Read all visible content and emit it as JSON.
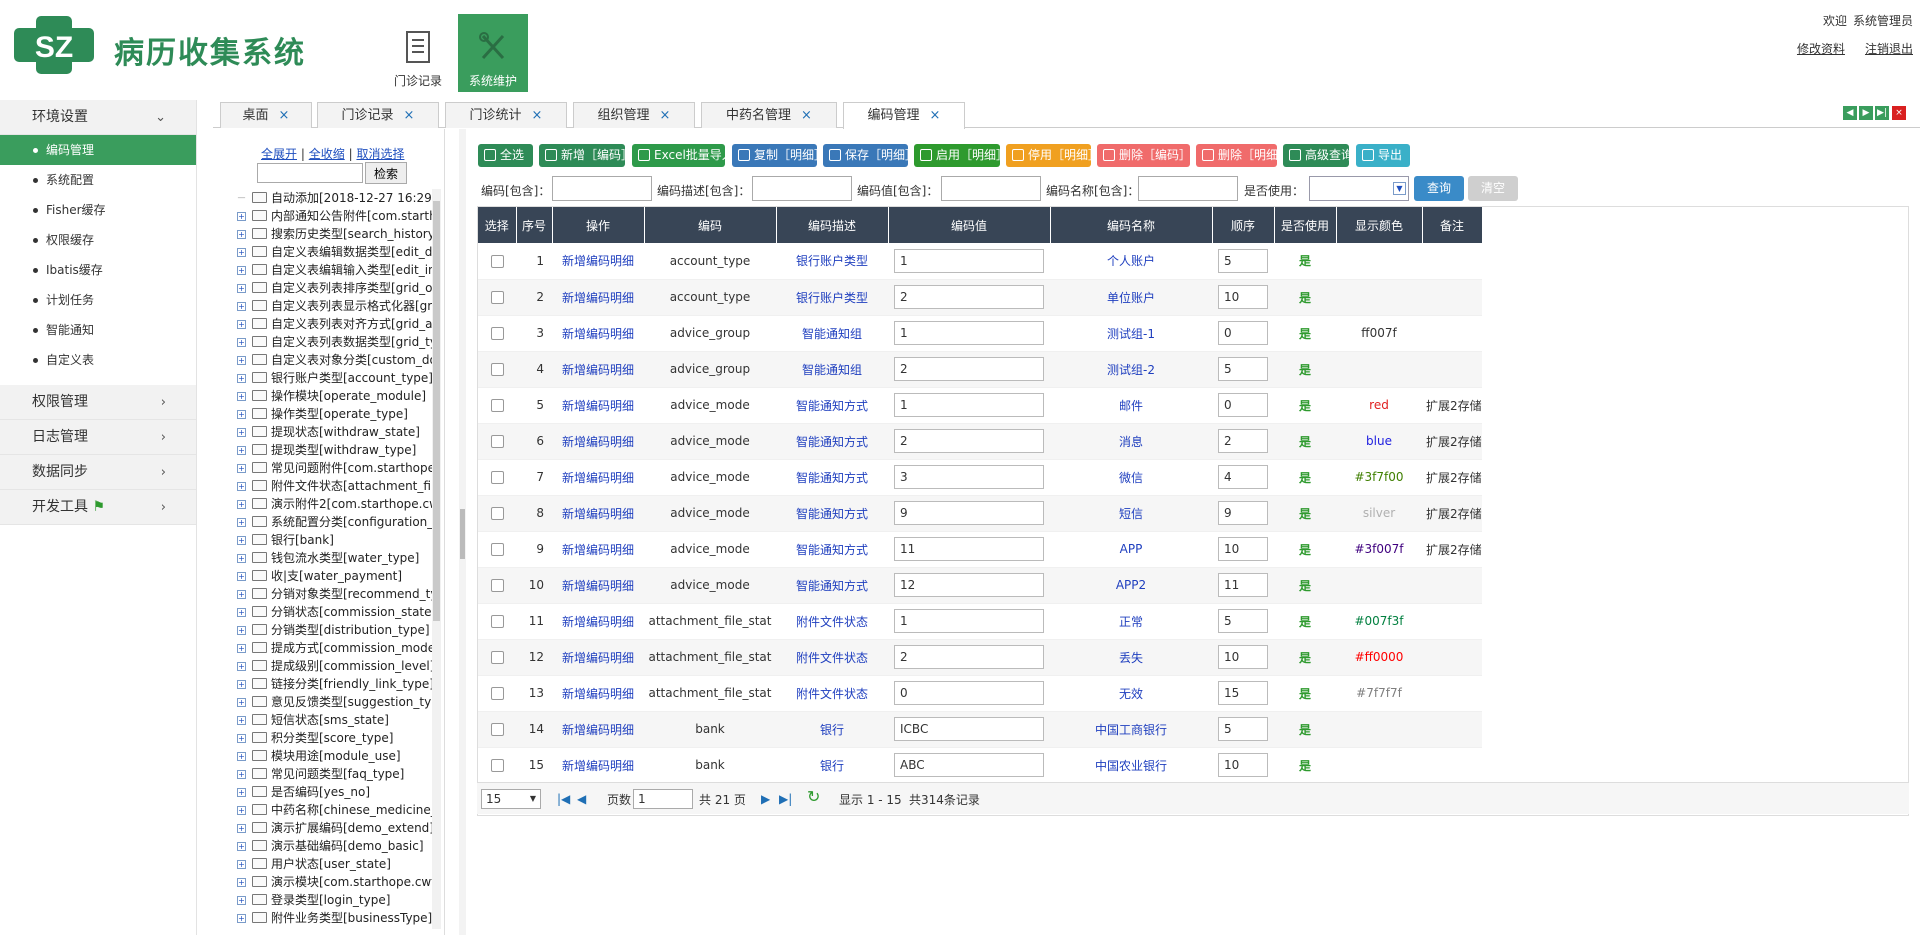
{
  "header": {
    "app_title": "病历收集系统",
    "logo_letters": "SZ",
    "top_buttons": [
      {
        "label": "门诊记录"
      },
      {
        "label": "系统维护"
      }
    ],
    "welcome": "欢迎",
    "user": "系统管理员",
    "links": {
      "edit_profile": "修改资料",
      "logout": "注销退出"
    }
  },
  "sidebar": {
    "groups": [
      {
        "label": "环境设置",
        "expanded": true
      },
      {
        "label": "权限管理"
      },
      {
        "label": "日志管理"
      },
      {
        "label": "数据同步"
      },
      {
        "label": "开发工具"
      }
    ],
    "items": [
      "编码管理",
      "系统配置",
      "Fisher缓存",
      "权限缓存",
      "Ibatis缓存",
      "计划任务",
      "智能通知",
      "自定义表"
    ],
    "active_item": "编码管理"
  },
  "tabs": [
    {
      "label": "桌面"
    },
    {
      "label": "门诊记录"
    },
    {
      "label": "门诊统计"
    },
    {
      "label": "组织管理"
    },
    {
      "label": "中药名管理"
    },
    {
      "label": "编码管理",
      "active": true
    }
  ],
  "tree": {
    "links": {
      "expand_all": "全展开",
      "sep1": "|",
      "collapse_all": "全收缩",
      "sep2": "|",
      "cancel": "取消选择"
    },
    "search_button": "检索",
    "nodes": [
      "自动添加[2018-12-27 16:29",
      "内部通知公告附件[com.starth",
      "搜索历史类型[search_history",
      "自定义表编辑数据类型[edit_da",
      "自定义表编辑输入类型[edit_in",
      "自定义表列表排序类型[grid_or",
      "自定义表列表显示格式化器[gri",
      "自定义表列表对齐方式[grid_al",
      "自定义表列表数据类型[grid_ty",
      "自定义表对象分类[custom_do",
      "银行账户类型[account_type]",
      "操作模块[operate_module]",
      "操作类型[operate_type]",
      "提现状态[withdraw_state]",
      "提现类型[withdraw_type]",
      "常见问题附件[com.starthope.",
      "附件文件状态[attachment_file",
      "演示附件2[com.starthope.cw",
      "系统配置分类[configuration_t",
      "银行[bank]",
      "钱包流水类型[water_type]",
      "收|支[water_payment]",
      "分销对象类型[recommend_ty",
      "分销状态[commission_state]",
      "分销类型[distribution_type]",
      "提成方式[commission_mode",
      "提成级别[commission_level]",
      "链接分类[friendly_link_type]",
      "意见反馈类型[suggestion_typ",
      "短信状态[sms_state]",
      "积分类型[score_type]",
      "模块用途[module_use]",
      "常见问题类型[faq_type]",
      "是否编码[yes_no]",
      "中药名称[chinese_medicine_",
      "演示扩展编码[demo_extend]",
      "演示基础编码[demo_basic]",
      "用户状态[user_state]",
      "演示模块[com.starthope.cwf",
      "登录类型[login_type]",
      "附件业务类型[businessType]"
    ]
  },
  "toolbar": {
    "buttons": [
      {
        "label": "全选",
        "color": "#2e8b57",
        "icon": "checkbox-icon"
      },
      {
        "label": "新增［编码］",
        "color": "#2e8b57",
        "icon": "plus-icon"
      },
      {
        "label": "Excel批量导入",
        "color": "#2e9a4a",
        "icon": "edit-icon"
      },
      {
        "label": "复制［明细］",
        "color": "#3a78b8",
        "icon": "copy-icon"
      },
      {
        "label": "保存［明细］",
        "color": "#3a78b8",
        "icon": "save-icon"
      },
      {
        "label": "启用［明细］",
        "color": "#2e9a2e",
        "icon": "play-icon"
      },
      {
        "label": "停用［明细］",
        "color": "#f0a020",
        "icon": "stop-icon"
      },
      {
        "label": "删除［编码］",
        "color": "#f06b6b",
        "icon": "trash-icon"
      },
      {
        "label": "删除［明细］",
        "color": "#f06b6b",
        "icon": "trash-icon"
      },
      {
        "label": "高级查询",
        "color": "#2e8b57",
        "icon": "search-icon"
      },
      {
        "label": "导出",
        "color": "#3ab0c8",
        "icon": "export-icon"
      }
    ]
  },
  "filter": {
    "code_label": "编码[包含]：",
    "desc_label": "编码描述[包含]：",
    "value_label": "编码值[包含]：",
    "name_label": "编码名称[包含]：",
    "use_label": "是否使用：",
    "query_button": "查询",
    "clear_button": "清空"
  },
  "grid": {
    "columns": [
      "选择",
      "序号",
      "操作",
      "编码",
      "编码描述",
      "编码值",
      "编码名称",
      "顺序",
      "是否使用",
      "显示颜色",
      "备注"
    ],
    "rows": [
      {
        "no": "1",
        "op": "新增编码明细",
        "code": "account_type",
        "desc": "银行账户类型",
        "value": "1",
        "name": "个人账户",
        "order": "5",
        "used": "是",
        "color": "",
        "color_hex": "#333333",
        "note": ""
      },
      {
        "no": "2",
        "op": "新增编码明细",
        "code": "account_type",
        "desc": "银行账户类型",
        "value": "2",
        "name": "单位账户",
        "order": "10",
        "used": "是",
        "color": "",
        "color_hex": "#333333",
        "note": ""
      },
      {
        "no": "3",
        "op": "新增编码明细",
        "code": "advice_group",
        "desc": "智能通知组",
        "value": "1",
        "name": "测试组-1",
        "order": "0",
        "used": "是",
        "color": "ff007f",
        "color_hex": "#333333",
        "note": ""
      },
      {
        "no": "4",
        "op": "新增编码明细",
        "code": "advice_group",
        "desc": "智能通知组",
        "value": "2",
        "name": "测试组-2",
        "order": "5",
        "used": "是",
        "color": "",
        "color_hex": "#333333",
        "note": ""
      },
      {
        "no": "5",
        "op": "新增编码明细",
        "code": "advice_mode",
        "desc": "智能通知方式",
        "value": "1",
        "name": "邮件",
        "order": "0",
        "used": "是",
        "color": "red",
        "color_hex": "#e02020",
        "note": "扩展2存储"
      },
      {
        "no": "6",
        "op": "新增编码明细",
        "code": "advice_mode",
        "desc": "智能通知方式",
        "value": "2",
        "name": "消息",
        "order": "2",
        "used": "是",
        "color": "blue",
        "color_hex": "#2020e0",
        "note": "扩展2存储"
      },
      {
        "no": "7",
        "op": "新增编码明细",
        "code": "advice_mode",
        "desc": "智能通知方式",
        "value": "3",
        "name": "微信",
        "order": "4",
        "used": "是",
        "color": "#3f7f00",
        "color_hex": "#3f7f00",
        "note": "扩展2存储"
      },
      {
        "no": "8",
        "op": "新增编码明细",
        "code": "advice_mode",
        "desc": "智能通知方式",
        "value": "9",
        "name": "短信",
        "order": "9",
        "used": "是",
        "color": "silver",
        "color_hex": "#b0b0b0",
        "note": "扩展2存储"
      },
      {
        "no": "9",
        "op": "新增编码明细",
        "code": "advice_mode",
        "desc": "智能通知方式",
        "value": "11",
        "name": "APP",
        "order": "10",
        "used": "是",
        "color": "#3f007f",
        "color_hex": "#3f007f",
        "note": "扩展2存储"
      },
      {
        "no": "10",
        "op": "新增编码明细",
        "code": "advice_mode",
        "desc": "智能通知方式",
        "value": "12",
        "name": "APP2",
        "order": "11",
        "used": "是",
        "color": "",
        "color_hex": "#333333",
        "note": ""
      },
      {
        "no": "11",
        "op": "新增编码明细",
        "code": "attachment_file_stat",
        "desc": "附件文件状态",
        "value": "1",
        "name": "正常",
        "order": "5",
        "used": "是",
        "color": "#007f3f",
        "color_hex": "#007f3f",
        "note": ""
      },
      {
        "no": "12",
        "op": "新增编码明细",
        "code": "attachment_file_stat",
        "desc": "附件文件状态",
        "value": "2",
        "name": "丢失",
        "order": "10",
        "used": "是",
        "color": "#ff0000",
        "color_hex": "#ff0000",
        "note": ""
      },
      {
        "no": "13",
        "op": "新增编码明细",
        "code": "attachment_file_stat",
        "desc": "附件文件状态",
        "value": "0",
        "name": "无效",
        "order": "15",
        "used": "是",
        "color": "#7f7f7f",
        "color_hex": "#7f7f7f",
        "note": ""
      },
      {
        "no": "14",
        "op": "新增编码明细",
        "code": "bank",
        "desc": "银行",
        "value": "ICBC",
        "name": "中国工商银行",
        "order": "5",
        "used": "是",
        "color": "",
        "color_hex": "#333333",
        "note": ""
      },
      {
        "no": "15",
        "op": "新增编码明细",
        "code": "bank",
        "desc": "银行",
        "value": "ABC",
        "name": "中国农业银行",
        "order": "10",
        "used": "是",
        "color": "",
        "color_hex": "#333333",
        "note": ""
      }
    ]
  },
  "pager": {
    "page_size": "15",
    "page_label": "页数",
    "page_value": "1",
    "total_pages": "共 21 页",
    "showing": "显示 1 - 15",
    "total": "共314条记录"
  }
}
